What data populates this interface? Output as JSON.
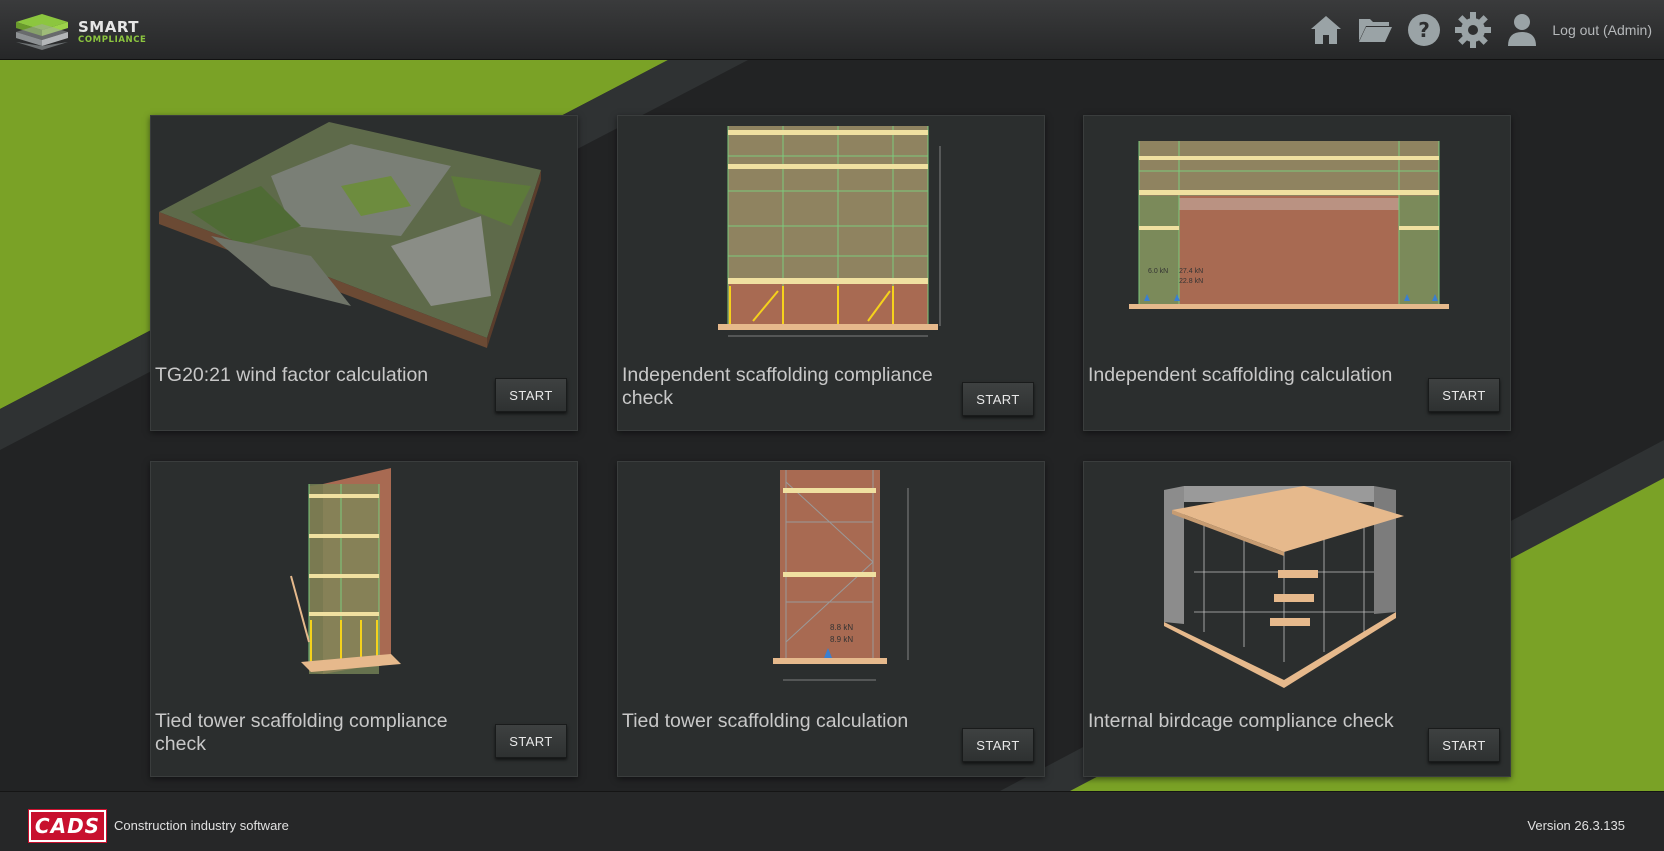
{
  "header": {
    "logo_line1": "SMART",
    "logo_line2": "COMPLIANCE",
    "logout_label": "Log out (Admin)",
    "nav_icons": [
      "home-icon",
      "folder-icon",
      "help-icon",
      "settings-icon",
      "user-icon"
    ]
  },
  "cards": [
    {
      "title": "TG20:21 wind factor calculation",
      "button": "START"
    },
    {
      "title": "Independent scaffolding compliance check",
      "button": "START"
    },
    {
      "title": "Independent scaffolding calculation",
      "button": "START"
    },
    {
      "title": "Tied tower scaffolding compliance check",
      "button": "START"
    },
    {
      "title": "Tied tower scaffolding calculation",
      "button": "START"
    },
    {
      "title": "Internal birdcage compliance check",
      "button": "START"
    }
  ],
  "thumb_labels": {
    "ind_calc": [
      "6.0 kN",
      "27.4 kN",
      "22.8 kN"
    ],
    "tied_calc": [
      "8.8 kN",
      "8.9 kN"
    ]
  },
  "footer": {
    "logo_text": "CADS",
    "tagline": "Construction industry software",
    "version": "Version 26.3.135"
  },
  "colors": {
    "accent_green": "#7aa226",
    "header_bg": "#2e2f30",
    "card_bg": "#2b2e2e",
    "brand_red": "#c8102e"
  }
}
